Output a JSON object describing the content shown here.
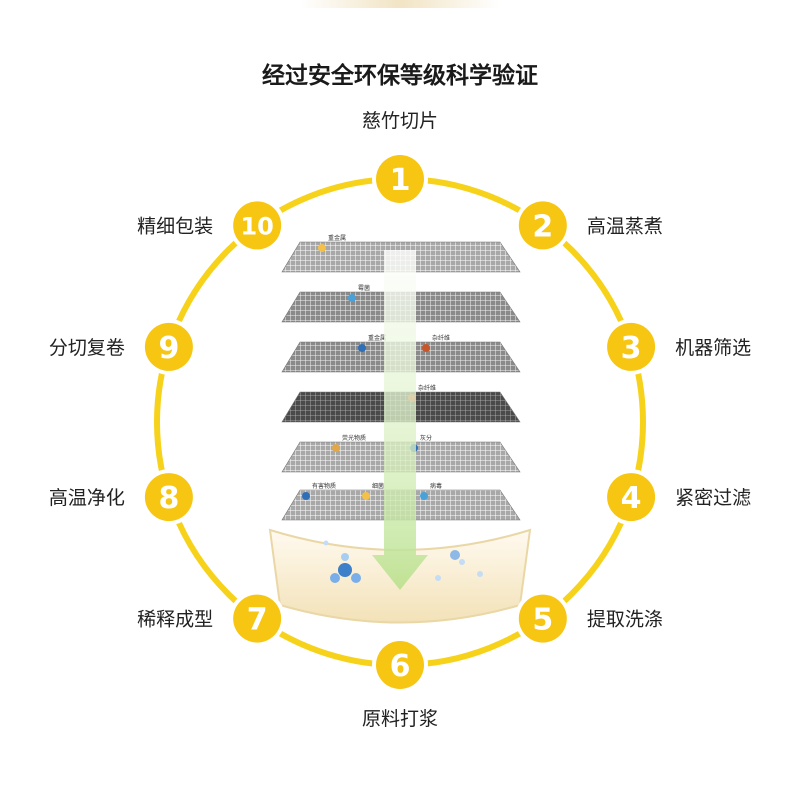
{
  "title": "经过安全环保等级科学验证",
  "colors": {
    "ring": "#f7d21a",
    "circle": "#f6c613",
    "number": "#ffffff",
    "label": "#222222"
  },
  "steps": [
    {
      "num": "1",
      "label": "慈竹切片"
    },
    {
      "num": "2",
      "label": "高温蒸煮"
    },
    {
      "num": "3",
      "label": "机器筛选"
    },
    {
      "num": "4",
      "label": "紧密过滤"
    },
    {
      "num": "5",
      "label": "提取洗涤"
    },
    {
      "num": "6",
      "label": "原料打浆"
    },
    {
      "num": "7",
      "label": "稀释成型"
    },
    {
      "num": "8",
      "label": "高温净化"
    },
    {
      "num": "9",
      "label": "分切复卷"
    },
    {
      "num": "10",
      "label": "精细包装"
    }
  ],
  "filter_layers": [
    {
      "labels": [
        "重金属"
      ]
    },
    {
      "labels": [
        "霉菌"
      ]
    },
    {
      "labels": [
        "重金属",
        "杂纤维"
      ]
    },
    {
      "labels": [
        "杂纤维"
      ]
    },
    {
      "labels": [
        "荧光物质",
        "灰分"
      ]
    },
    {
      "labels": [
        "有害物质",
        "细菌",
        "病毒"
      ]
    }
  ]
}
